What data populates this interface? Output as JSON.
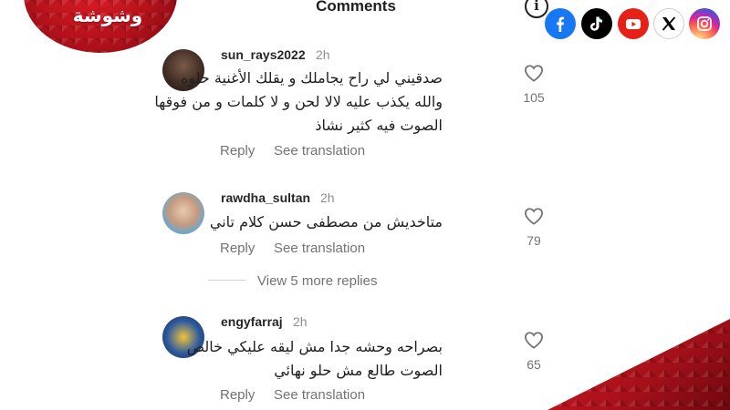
{
  "brand": {
    "logo_text": "وشوشة"
  },
  "header": {
    "title": "Comments",
    "info_icon": "info-circle-icon"
  },
  "social": [
    {
      "name": "facebook-icon",
      "glyph": "f",
      "color": "#1877f2"
    },
    {
      "name": "tiktok-icon",
      "glyph": "♪",
      "color": "#000000"
    },
    {
      "name": "youtube-icon",
      "glyph": "▶",
      "color": "#e62117"
    },
    {
      "name": "x-icon",
      "glyph": "X",
      "color": "#000000"
    },
    {
      "name": "instagram-icon",
      "glyph": "◎",
      "color": "#d6249f"
    }
  ],
  "comments": [
    {
      "username": "sun_rays2022",
      "time": "2h",
      "lines": [
        "صدقيني لي راح يجاملك و يقلك الأغنية حلوه",
        "والله يكذب عليه لالا لحن و لا كلمات و من فوقها",
        "الصوت فيه كثير نشاذ"
      ],
      "likes": "105",
      "reply_label": "Reply",
      "translate_label": "See translation"
    },
    {
      "username": "rawdha_sultan",
      "time": "2h",
      "lines": [
        "متاخديش من مصطفى حسن كلام تاني"
      ],
      "likes": "79",
      "reply_label": "Reply",
      "translate_label": "See translation"
    },
    {
      "username": "engyfarraj",
      "time": "2h",
      "lines": [
        "بصراحه وحشه جدا مش ليقه عليكي خالص",
        "الصوت طالع مش حلو نهائي"
      ],
      "likes": "65",
      "reply_label": "Reply",
      "translate_label": "See translation"
    }
  ],
  "more_replies": {
    "label": "View 5 more replies"
  },
  "colors": {
    "accent_red": "#c8151f",
    "muted_text": "#737373"
  }
}
